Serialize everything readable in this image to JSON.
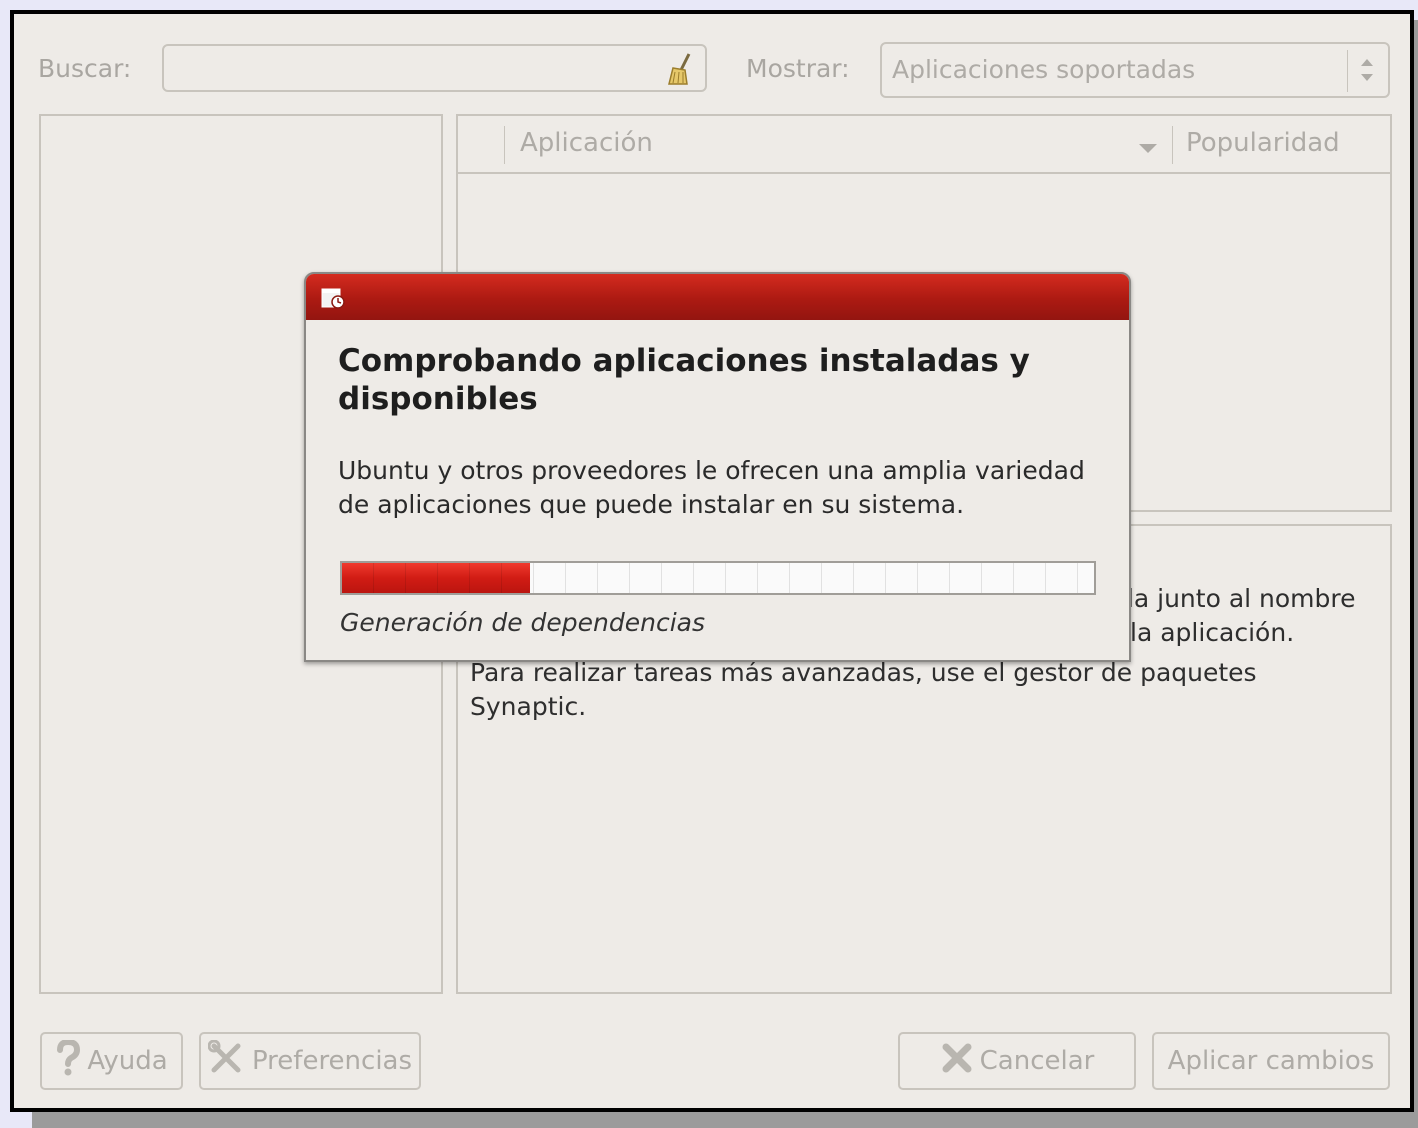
{
  "search": {
    "label": "Buscar:",
    "value": "",
    "clear_icon": "broom-icon"
  },
  "filter": {
    "label": "Mostrar:",
    "selected": "Aplicaciones soportadas"
  },
  "list": {
    "columns": [
      "Aplicación",
      "Popularidad"
    ],
    "sort_indicator": "chevron-down-icon"
  },
  "description": {
    "lines": [
      "da junto al nombre",
      "la aplicación.",
      "Para realizar tareas más avanzadas, use el gestor de paquetes",
      "Synaptic."
    ]
  },
  "buttons": {
    "help": "Ayuda",
    "preferences": "Preferencias",
    "cancel": "Cancelar",
    "apply": "Aplicar cambios"
  },
  "dialog": {
    "heading": "Comprobando aplicaciones instaladas y disponibles",
    "body": "Ubuntu y otros proveedores le ofrecen una amplia variedad de aplicaciones que puede instalar en su sistema.",
    "progress_fraction": 0.25,
    "status": "Generación de dependencias",
    "accent_color": "#b01c14"
  }
}
